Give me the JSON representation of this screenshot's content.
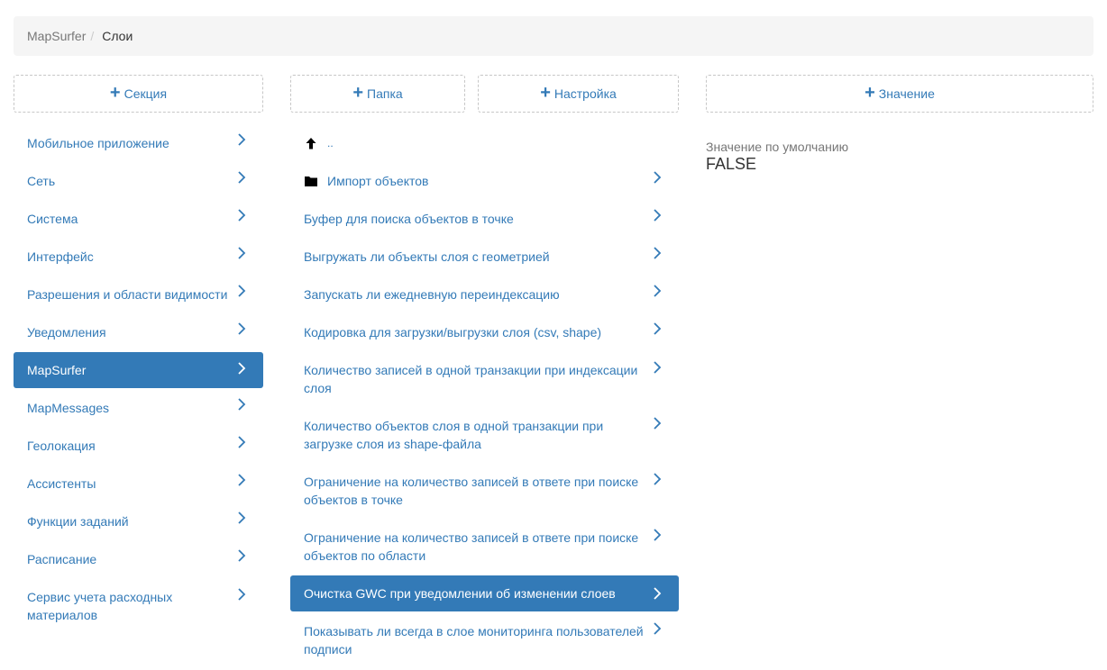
{
  "breadcrumb": {
    "root": "MapSurfer",
    "separator": "/",
    "current": "Слои"
  },
  "buttons": {
    "section": "Секция",
    "folder": "Папка",
    "setting": "Настройка",
    "value": "Значение"
  },
  "sections": [
    "Мобильное приложение",
    "Сеть",
    "Система",
    "Интерфейс",
    "Разрешения и области видимости",
    "Уведомления",
    "MapSurfer",
    "MapMessages",
    "Геолокация",
    "Ассистенты",
    "Функции заданий",
    "Расписание",
    "Сервис учета расходных материалов"
  ],
  "settings": {
    "up": "..",
    "folder": "Импорт объектов",
    "items": [
      "Буфер для поиска объектов в точке",
      "Выгружать ли объекты слоя с геометрией",
      "Запускать ли ежедневную переиндексацию",
      "Кодировка для загрузки/выгрузки слоя (csv, shape)",
      "Количество записей в одной транзакции при индексации слоя",
      "Количество объектов слоя в одной транзакции при загрузке слоя из shape-файла",
      "Ограничение на количество записей в ответе при поиске объектов в точке",
      "Ограничение на количество записей в ответе при поиске объектов по области",
      "Очистка GWC при уведомлении об изменении слоев",
      "Показывать ли всегда в слое мониторинга пользователей подписи"
    ]
  },
  "detail": {
    "label": "Значение по умолчанию",
    "value": "FALSE"
  },
  "colors": {
    "link": "#337ab7",
    "active_bg": "#337ab7",
    "breadcrumb_bg": "#f5f5f5"
  },
  "selection": {
    "section": "MapSurfer",
    "setting": "Очистка GWC при уведомлении об изменении слоев"
  }
}
